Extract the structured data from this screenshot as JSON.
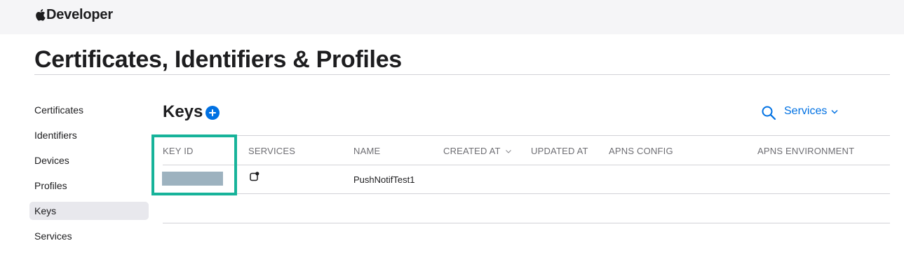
{
  "header": {
    "brand_icon": "apple-logo-icon",
    "brand_label": "Developer"
  },
  "page": {
    "title": "Certificates, Identifiers & Profiles"
  },
  "sidebar": {
    "items": [
      {
        "label": "Certificates",
        "active": false
      },
      {
        "label": "Identifiers",
        "active": false
      },
      {
        "label": "Devices",
        "active": false
      },
      {
        "label": "Profiles",
        "active": false
      },
      {
        "label": "Keys",
        "active": true
      },
      {
        "label": "Services",
        "active": false
      }
    ]
  },
  "section": {
    "title": "Keys",
    "add_icon": "plus-circle-icon",
    "search_icon": "search-icon",
    "filter_label": "Services",
    "filter_icon": "chevron-down-icon"
  },
  "table": {
    "columns": [
      "KEY ID",
      "SERVICES",
      "NAME",
      "CREATED AT",
      "UPDATED AT",
      "APNS CONFIG",
      "APNS ENVIRONMENT"
    ],
    "sort_column": "CREATED AT",
    "rows": [
      {
        "key_id": "",
        "key_id_redacted": true,
        "services_icon": "push-notification-icon",
        "name": "PushNotifTest1",
        "created_at": "",
        "updated_at": "",
        "apns_config": "",
        "apns_environment": ""
      }
    ]
  },
  "colors": {
    "accent": "#0071e3",
    "highlight_border": "#17b39a",
    "redaction": "#9db2bf",
    "active_sidebar_bg": "#e8e8ed"
  }
}
